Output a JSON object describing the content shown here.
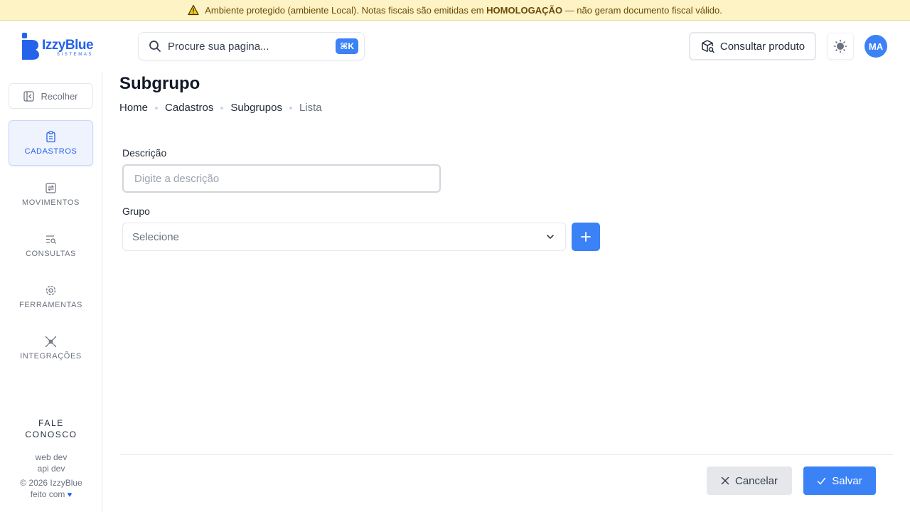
{
  "banner": {
    "text_before": "Ambiente protegido (ambiente Local). Notas fiscais são emitidas em",
    "highlight": "HOMOLOGAÇÃO",
    "text_after": "— não geram documento fiscal válido.",
    "icon": "warning-icon"
  },
  "brand": {
    "name": "IzzyBlue",
    "subtitle": "SISTEMAS",
    "color": "#2563eb"
  },
  "search": {
    "placeholder": "Procure sua pagina...",
    "shortcut": "⌘K",
    "icon": "search-icon"
  },
  "header": {
    "consult_label": "Consultar produto",
    "consult_icon": "package-search-icon",
    "theme_icon": "sun-icon",
    "avatar_initials": "MA"
  },
  "sidebar": {
    "collapse_label": "Recolher",
    "items": [
      {
        "label": "CADASTROS",
        "icon": "clipboard-icon",
        "active": true
      },
      {
        "label": "MOVIMENTOS",
        "icon": "transfer-icon",
        "active": false
      },
      {
        "label": "CONSULTAS",
        "icon": "list-search-icon",
        "active": false
      },
      {
        "label": "FERRAMENTAS",
        "icon": "gear-icon",
        "active": false
      },
      {
        "label": "INTEGRAÇÕES",
        "icon": "plug-icon",
        "active": false
      }
    ],
    "contact_line1": "FALE",
    "contact_line2": "CONOSCO",
    "env_web": "web dev",
    "env_api": "api dev",
    "copyright": "© 2026 IzzyBlue",
    "made_with": "feito com"
  },
  "page": {
    "title": "Subgrupo",
    "breadcrumb": [
      "Home",
      "Cadastros",
      "Subgrupos",
      "Lista"
    ]
  },
  "form": {
    "description_label": "Descrição",
    "description_placeholder": "Digite a descrição",
    "description_value": "",
    "group_label": "Grupo",
    "group_selected": "Selecione"
  },
  "actions": {
    "cancel_label": "Cancelar",
    "save_label": "Salvar"
  },
  "colors": {
    "accent": "#3b82f6",
    "banner_bg": "#fdf3c4",
    "active_nav_bg": "#eef3fe"
  }
}
